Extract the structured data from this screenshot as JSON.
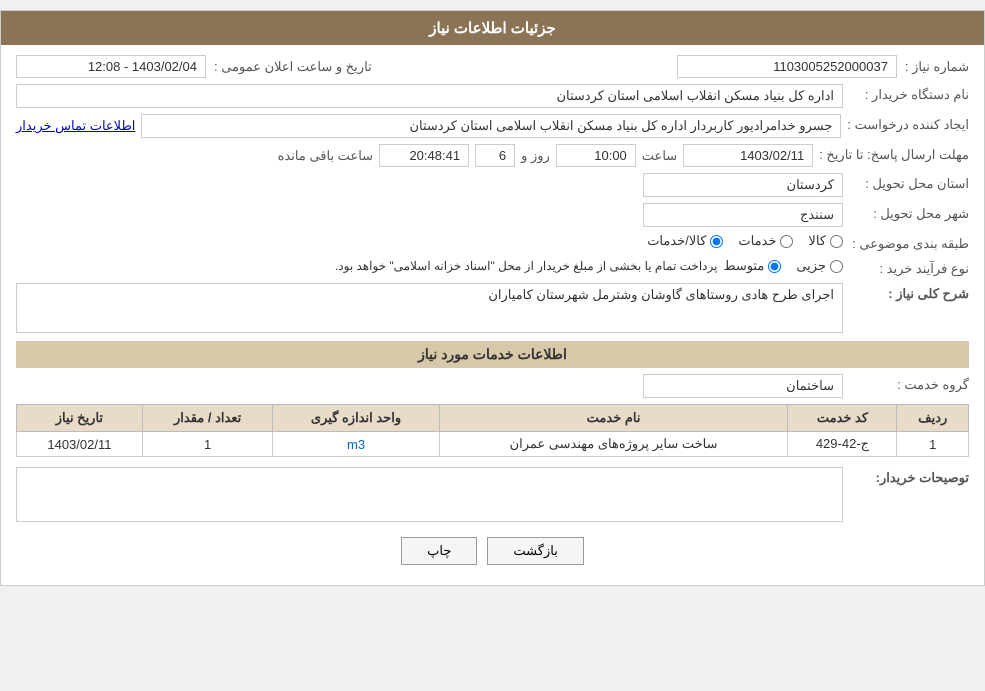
{
  "page": {
    "title": "جزئیات اطلاعات نیاز",
    "fields": {
      "shomareNiaz_label": "شماره نیاز :",
      "shomareNiaz_value": "1103005252000037",
      "namDastgah_label": "نام دستگاه خریدار :",
      "namDastgah_value": "اداره کل بنیاد مسکن انقلاب اسلامی استان کردستان",
      "ijadKonande_label": "ایجاد کننده درخواست :",
      "ijadKonande_value": "جسرو خدامرادیور کاربردار اداره کل بنیاد مسکن انقلاب اسلامی استان کردستان",
      "ettelaatTamas_label": "اطلاعات تماس خریدار",
      "mohlat_label": "مهلت ارسال پاسخ: تا تاریخ :",
      "date_value": "1403/02/11",
      "saat_label": "ساعت",
      "saat_value": "10:00",
      "roz_label": "روز و",
      "roz_value": "6",
      "remaining_label": "ساعت باقی مانده",
      "remaining_value": "20:48:41",
      "ostan_label": "استان محل تحویل :",
      "ostan_value": "کردستان",
      "shahr_label": "شهر محل تحویل :",
      "shahr_value": "سنندج",
      "tabaqeBandi_label": "طبقه بندی موضوعی :",
      "radio_kala": "کالا",
      "radio_khadamat": "خدمات",
      "radio_kala_khadamat": "کالا/خدمات",
      "noeFarayand_label": "نوع فرآیند خرید :",
      "radio_jozvi": "جزیی",
      "radio_motavaset": "متوسط",
      "farayand_text": "پرداخت تمام یا بخشی از مبلغ خریدار از محل \"اسناد خزانه اسلامی\" خواهد بود.",
      "sharh_label": "شرح کلی نیاز :",
      "sharh_value": "اجرای طرح هادی روستاهای گاوشان وشترمل شهرستان کامیاران",
      "khadamat_header": "اطلاعات خدمات مورد نیاز",
      "groheKhadamat_label": "گروه خدمت :",
      "groheKhadamat_value": "ساختمان",
      "table": {
        "headers": [
          "ردیف",
          "کد خدمت",
          "نام خدمت",
          "واحد اندازه گیری",
          "تعداد / مقدار",
          "تاریخ نیاز"
        ],
        "rows": [
          {
            "radif": "1",
            "kodKhadamat": "ج-42-429",
            "namKhadamat": "ساخت سایر پروژه‌های مهندسی عمران",
            "vahed": "m3",
            "tedad": "1",
            "tarikh": "1403/02/11"
          }
        ]
      },
      "tosihKharidar_label": "توصیحات خریدار:",
      "tosihKharidar_value": "",
      "tarikhElanOmomi_label": "تاریخ و ساعت اعلان عمومی :",
      "tarikhElanOmomi_value": "1403/02/04 - 12:08"
    },
    "buttons": {
      "print": "چاپ",
      "back": "بازگشت"
    }
  }
}
